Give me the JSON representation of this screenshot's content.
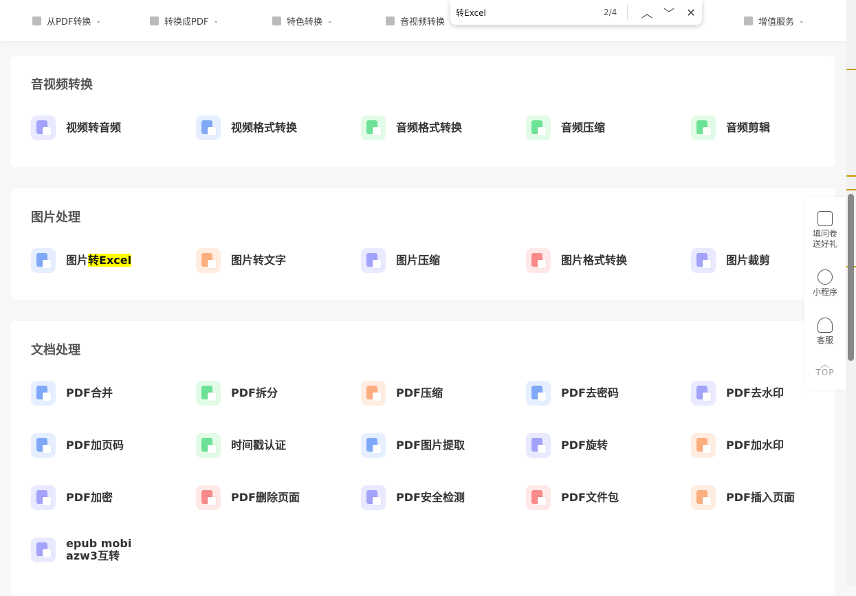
{
  "nav": [
    {
      "label": "从PDF转换"
    },
    {
      "label": "转换成PDF"
    },
    {
      "label": "特色转换"
    },
    {
      "label": "音视频转换"
    },
    {
      "label": "增值服务"
    }
  ],
  "find": {
    "query": "转Excel",
    "count": "2/4",
    "prev_icon": "chevron-up-icon",
    "next_icon": "chevron-down-icon",
    "close_icon": "close-icon"
  },
  "colors": {
    "highlight": "#ffff00",
    "purple": "#a3a3fb",
    "blue": "#7fa9f8",
    "green": "#6be295",
    "orange": "#fcae7f",
    "red": "#f88a8a"
  },
  "sections": [
    {
      "title": "音视频转换",
      "items": [
        {
          "label": "视频转音频",
          "theme": "purple"
        },
        {
          "label": "视频格式转换",
          "theme": "blue"
        },
        {
          "label": "音频格式转换",
          "theme": "green"
        },
        {
          "label": "音频压缩",
          "theme": "green"
        },
        {
          "label": "音频剪辑",
          "theme": "green"
        }
      ]
    },
    {
      "title": "图片处理",
      "items": [
        {
          "label": "图片",
          "highlight": "转Excel",
          "theme": "blue"
        },
        {
          "label": "图片转文字",
          "theme": "orange"
        },
        {
          "label": "图片压缩",
          "theme": "purple"
        },
        {
          "label": "图片格式转换",
          "theme": "red"
        },
        {
          "label": "图片裁剪",
          "theme": "purple"
        }
      ]
    },
    {
      "title": "文档处理",
      "items": [
        {
          "label": "PDF合并",
          "theme": "blue"
        },
        {
          "label": "PDF拆分",
          "theme": "green"
        },
        {
          "label": "PDF压缩",
          "theme": "orange"
        },
        {
          "label": "PDF去密码",
          "theme": "blue"
        },
        {
          "label": "PDF去水印",
          "theme": "purple"
        },
        {
          "label": "PDF加页码",
          "theme": "blue"
        },
        {
          "label": "时间戳认证",
          "theme": "green"
        },
        {
          "label": "PDF图片提取",
          "theme": "blue"
        },
        {
          "label": "PDF旋转",
          "theme": "purple"
        },
        {
          "label": "PDF加水印",
          "theme": "orange"
        },
        {
          "label": "PDF加密",
          "theme": "purple"
        },
        {
          "label": "PDF删除页面",
          "theme": "red"
        },
        {
          "label": "PDF安全检测",
          "theme": "purple"
        },
        {
          "label": "PDF文件包",
          "theme": "red"
        },
        {
          "label": "PDF插入页面",
          "theme": "orange"
        },
        {
          "label": "epub mobi azw3互转",
          "theme": "purple"
        }
      ]
    }
  ],
  "side": [
    {
      "label": "填问卷\n送好礼",
      "icon": "survey-icon"
    },
    {
      "label": "小程序",
      "icon": "mini-program-icon"
    },
    {
      "label": "客服",
      "icon": "headset-icon"
    },
    {
      "label": "TOP",
      "icon": "chevron-up-icon"
    }
  ]
}
